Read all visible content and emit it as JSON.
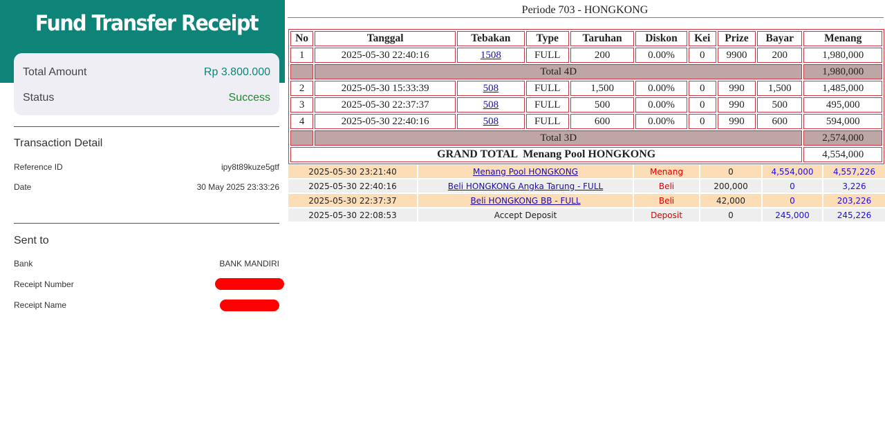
{
  "receipt": {
    "title": "Fund Transfer Receipt",
    "summary": {
      "amount_label": "Total Amount",
      "amount_value": "Rp 3.800.000",
      "status_label": "Status",
      "status_value": "Success"
    },
    "transaction_detail": {
      "title": "Transaction Detail",
      "reference_label": "Reference ID",
      "reference_value": "ipy8t89kuze5gtf",
      "date_label": "Date",
      "date_value": "30 May 2025 23:33:26"
    },
    "sent_to": {
      "title": "Sent to",
      "bank_label": "Bank",
      "bank_value": "BANK MANDIRI",
      "receipt_number_label": "Receipt Number",
      "receipt_name_label": "Receipt Name"
    },
    "colors": {
      "header": "#0e8478",
      "success": "#1c8a2a",
      "redaction": "#ff0000"
    }
  },
  "periode": {
    "title": "Periode 703 - HONGKONG",
    "columns": [
      "No",
      "Tanggal",
      "Tebakan",
      "Type",
      "Taruhan",
      "Diskon",
      "Kei",
      "Prize",
      "Bayar",
      "Menang"
    ],
    "rows_4d": [
      {
        "no": "1",
        "tanggal": "2025-05-30 22:40:16",
        "tebakan": "1508",
        "type": "FULL",
        "taruhan": "200",
        "diskon": "0.00%",
        "kei": "0",
        "prize": "9900",
        "bayar": "200",
        "menang": "1,980,000"
      }
    ],
    "total_4d": {
      "label": "Total 4D",
      "value": "1,980,000"
    },
    "rows_3d": [
      {
        "no": "2",
        "tanggal": "2025-05-30 15:33:39",
        "tebakan": "508",
        "type": "FULL",
        "taruhan": "1,500",
        "diskon": "0.00%",
        "kei": "0",
        "prize": "990",
        "bayar": "1,500",
        "menang": "1,485,000"
      },
      {
        "no": "3",
        "tanggal": "2025-05-30 22:37:37",
        "tebakan": "508",
        "type": "FULL",
        "taruhan": "500",
        "diskon": "0.00%",
        "kei": "0",
        "prize": "990",
        "bayar": "500",
        "menang": "495,000"
      },
      {
        "no": "4",
        "tanggal": "2025-05-30 22:40:16",
        "tebakan": "508",
        "type": "FULL",
        "taruhan": "600",
        "diskon": "0.00%",
        "kei": "0",
        "prize": "990",
        "bayar": "600",
        "menang": "594,000"
      }
    ],
    "total_3d": {
      "label": "Total 3D",
      "value": "2,574,000"
    },
    "grand_total": {
      "label": "GRAND TOTAL  Menang Pool HONGKONG",
      "value": "4,554,000"
    }
  },
  "log": [
    {
      "date": "2025-05-30 23:21:40",
      "desc": "Menang Pool HONGKONG",
      "link": true,
      "kind": "Menang",
      "debit": "0",
      "credit": "4,554,000",
      "balance": "4,557,226"
    },
    {
      "date": "2025-05-30 22:40:16",
      "desc": "Beli HONGKONG Angka Tarung - FULL",
      "link": true,
      "kind": "Beli",
      "debit": "200,000",
      "credit": "0",
      "balance": "3,226"
    },
    {
      "date": "2025-05-30 22:37:37",
      "desc": "Beli HONGKONG BB - FULL",
      "link": true,
      "kind": "Beli",
      "debit": "42,000",
      "credit": "0",
      "balance": "203,226"
    },
    {
      "date": "2025-05-30 22:08:53",
      "desc": "Accept Deposit",
      "link": false,
      "kind": "Deposit",
      "debit": "0",
      "credit": "245,000",
      "balance": "245,226"
    }
  ]
}
